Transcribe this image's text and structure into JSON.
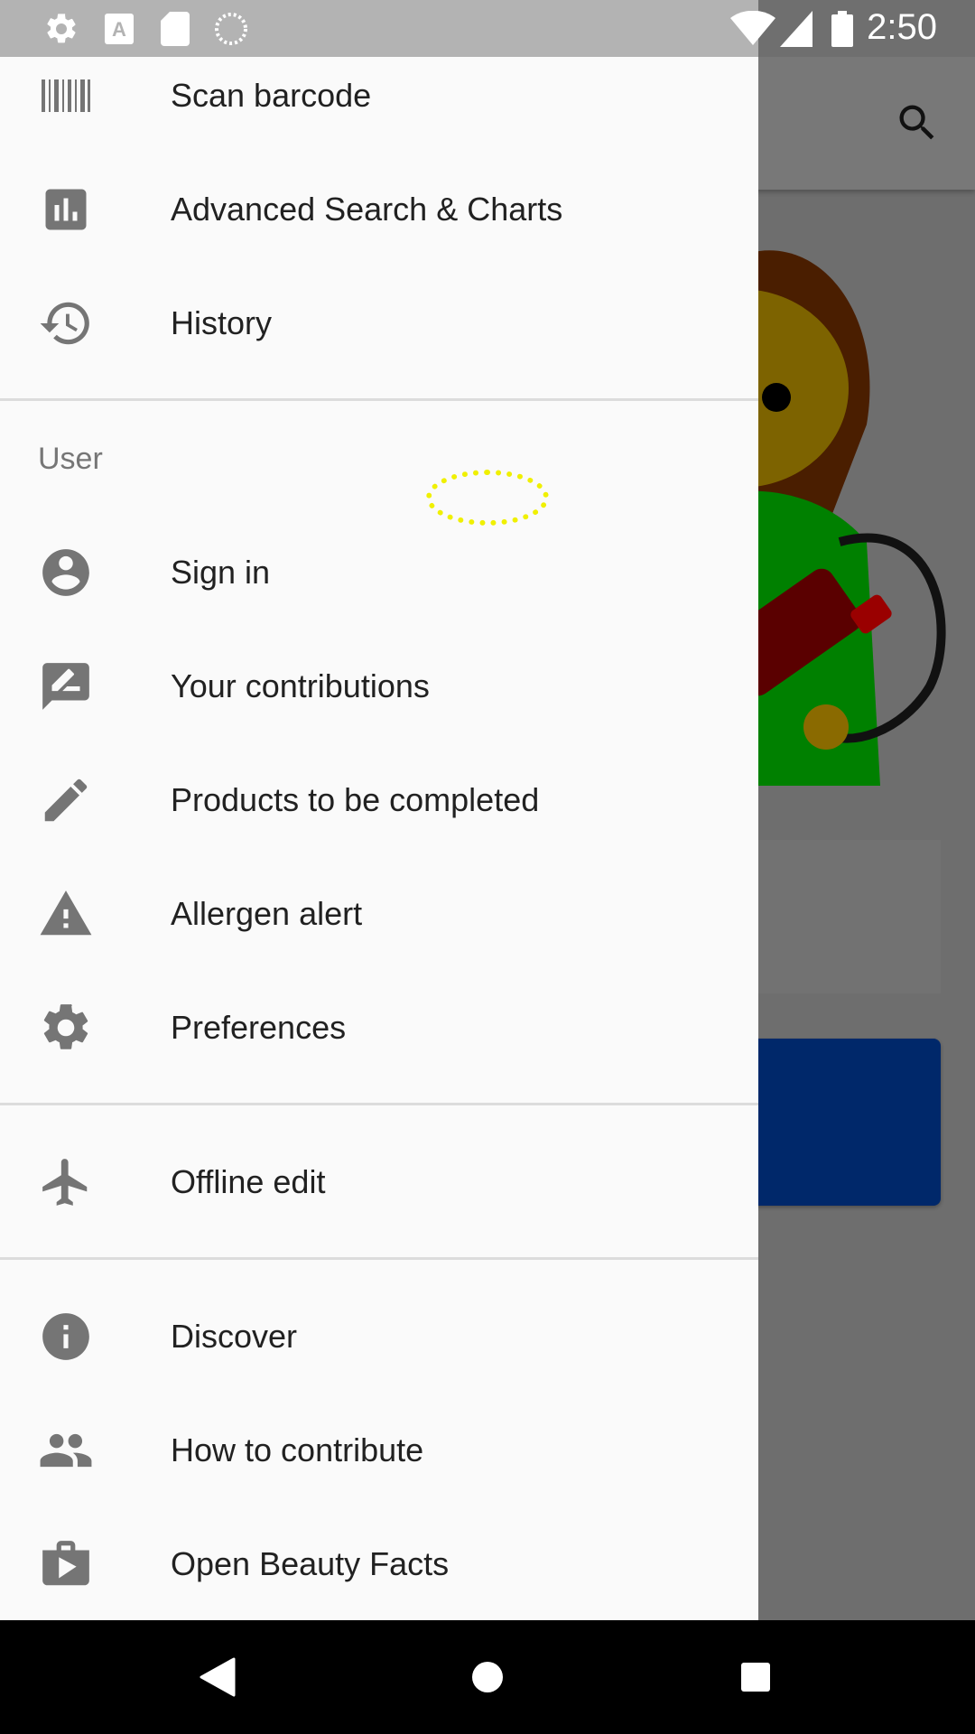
{
  "status_bar": {
    "time": "2:50",
    "left_icons": [
      "gear-icon",
      "font-a-icon",
      "sd-card-icon",
      "loading-circle-icon"
    ],
    "right_icons": [
      "wifi-icon",
      "signal-icon",
      "battery-icon"
    ]
  },
  "background_app": {
    "toolbar_icon": "search-icon",
    "button_color": "#00286a"
  },
  "drawer": {
    "top_items": [
      {
        "label": "Scan barcode",
        "icon": "barcode-icon"
      },
      {
        "label": "Advanced Search & Charts",
        "icon": "bar-chart-icon"
      },
      {
        "label": "History",
        "icon": "history-icon"
      }
    ],
    "user_section": {
      "header": "User",
      "items": [
        {
          "label": "Sign in",
          "icon": "account-circle-icon"
        },
        {
          "label": "Your contributions",
          "icon": "rate-review-icon"
        },
        {
          "label": "Products to be completed",
          "icon": "pencil-icon"
        },
        {
          "label": "Allergen alert",
          "icon": "warning-icon"
        },
        {
          "label": "Preferences",
          "icon": "settings-icon"
        }
      ]
    },
    "offline_items": [
      {
        "label": "Offline edit",
        "icon": "airplane-icon"
      }
    ],
    "bottom_items": [
      {
        "label": "Discover",
        "icon": "info-icon"
      },
      {
        "label": "How to contribute",
        "icon": "people-icon"
      },
      {
        "label": "Open Beauty Facts",
        "icon": "shop-icon"
      }
    ]
  },
  "nav_bar": {
    "buttons": [
      "back-icon",
      "home-icon",
      "recents-icon"
    ]
  },
  "colors": {
    "drawer_bg": "#fafafa",
    "icon_gray": "#757575",
    "text": "#212121",
    "scrim": "#6e6e6e"
  }
}
